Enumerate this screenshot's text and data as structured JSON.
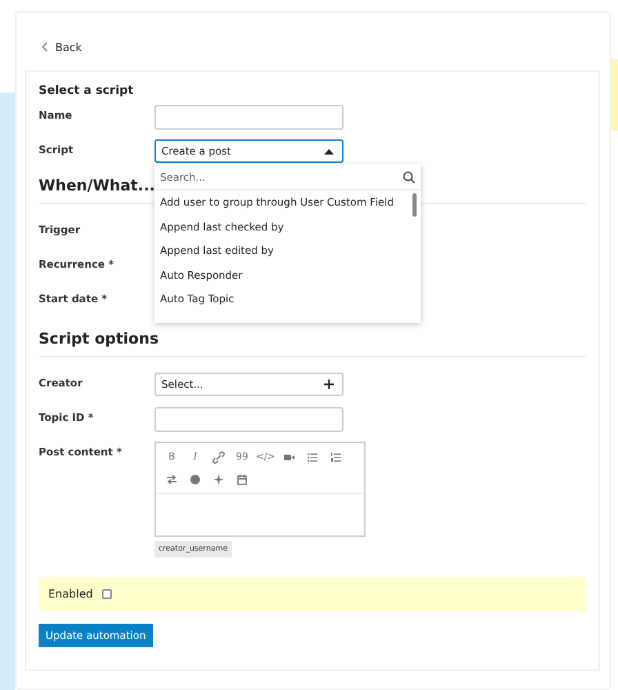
{
  "back_link": "Back",
  "select_script": {
    "heading": "Select a script",
    "fields": [
      {
        "label": "Name",
        "kind": "text"
      },
      {
        "label": "Script",
        "kind": "select",
        "value": "Create a post",
        "expanded": true
      }
    ]
  },
  "when_what": {
    "heading": "When/What...",
    "fields": [
      {
        "label": "Trigger"
      },
      {
        "label": "Recurrence *"
      },
      {
        "label": "Start date *"
      }
    ]
  },
  "script_dropdown": {
    "placeholder": "Search...",
    "options": [
      {
        "label": "Add user to group through User Custom Field"
      },
      {
        "label": "Append last checked by"
      },
      {
        "label": "Append last edited by"
      },
      {
        "label": "Auto Responder"
      },
      {
        "label": "Auto Tag Topic"
      }
    ]
  },
  "script_options": {
    "heading": "Script options",
    "fields": [
      {
        "label": "Creator",
        "kind": "combo",
        "value": "Select..."
      },
      {
        "label": "Topic ID *",
        "kind": "text"
      },
      {
        "label": "Post content *",
        "kind": "editor",
        "toolbar": [
          {
            "kind": "bold",
            "glyph": "B"
          },
          {
            "kind": "italic",
            "glyph": "I"
          },
          {
            "kind": "link"
          },
          {
            "kind": "quote",
            "glyph": "99"
          },
          {
            "kind": "code",
            "glyph": "</>"
          },
          {
            "kind": "video"
          },
          {
            "kind": "bullets"
          },
          {
            "kind": "numbers"
          },
          {
            "kind": "swap"
          },
          {
            "kind": "emoji"
          },
          {
            "kind": "sparkle"
          },
          {
            "kind": "calendar"
          }
        ],
        "placeholders": [
          "creator_username"
        ]
      }
    ]
  },
  "enabled": {
    "label": "Enabled",
    "checked": false
  },
  "submit_button": "Update automation"
}
